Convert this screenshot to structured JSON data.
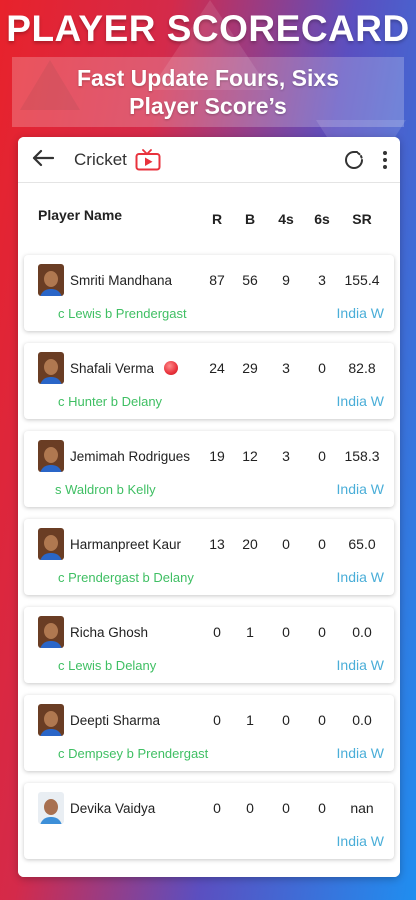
{
  "promo": {
    "headline": "PLAYER SCORECARD",
    "subline1": "Fast Update Fours, Sixs",
    "subline2": "Player Score’s"
  },
  "appbar": {
    "back_icon": "back-arrow-icon",
    "title": "Cricket",
    "tv_icon": "tv-play-icon",
    "refresh_icon": "refresh-icon",
    "menu_icon": "more-vert-icon"
  },
  "table": {
    "headers": {
      "name": "Player Name",
      "r": "R",
      "b": "B",
      "fours": "4s",
      "sixes": "6s",
      "sr": "SR"
    },
    "rows": [
      {
        "name": "Smriti Mandhana",
        "r": "87",
        "b": "56",
        "fours": "9",
        "sixes": "3",
        "sr": "155.4",
        "dismissal": "c Lewis b Prendergast",
        "team": "India W"
      },
      {
        "name": "Shafali Verma",
        "r": "24",
        "b": "29",
        "fours": "3",
        "sixes": "0",
        "sr": "82.8",
        "dismissal": "c Hunter b Delany",
        "team": "India W"
      },
      {
        "name": "Jemimah Rodrigues",
        "r": "19",
        "b": "12",
        "fours": "3",
        "sixes": "0",
        "sr": "158.3",
        "dismissal": "s Waldron b Kelly",
        "team": "India W"
      },
      {
        "name": "Harmanpreet Kaur",
        "r": "13",
        "b": "20",
        "fours": "0",
        "sixes": "0",
        "sr": "65.0",
        "dismissal": "c Prendergast b Delany",
        "team": "India W"
      },
      {
        "name": "Richa Ghosh",
        "r": "0",
        "b": "1",
        "fours": "0",
        "sixes": "0",
        "sr": "0.0",
        "dismissal": "c Lewis b Delany",
        "team": "India W"
      },
      {
        "name": "Deepti Sharma",
        "r": "0",
        "b": "1",
        "fours": "0",
        "sixes": "0",
        "sr": "0.0",
        "dismissal": "c Dempsey b Prendergast",
        "team": "India W"
      },
      {
        "name": "Devika Vaidya",
        "r": "0",
        "b": "0",
        "fours": "0",
        "sixes": "0",
        "sr": "nan",
        "dismissal": "",
        "team": "India W"
      }
    ]
  },
  "colors": {
    "dismissal": "#3fbf63",
    "team": "#4aaed8",
    "live_ball": "#e8323c"
  }
}
